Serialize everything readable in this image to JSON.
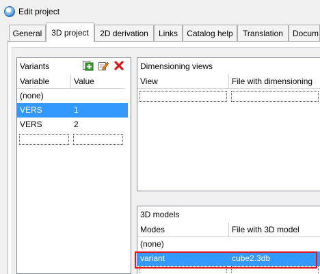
{
  "window": {
    "title": "Edit project"
  },
  "tabs": [
    {
      "label": "General",
      "active": false
    },
    {
      "label": "3D project",
      "active": true
    },
    {
      "label": "2D derivation",
      "active": false
    },
    {
      "label": "Links",
      "active": false
    },
    {
      "label": "Catalog help",
      "active": false
    },
    {
      "label": "Translation",
      "active": false
    },
    {
      "label": "Docum",
      "active": false
    }
  ],
  "variants": {
    "title": "Variants",
    "toolbar": {
      "add_icon": "add-icon",
      "edit_icon": "edit-icon",
      "delete_icon": "delete-icon"
    },
    "columns": [
      "Variable",
      "Value"
    ],
    "rows": [
      {
        "variable": "(none)",
        "value": ""
      },
      {
        "variable": "VERS",
        "value": "1",
        "selected": true
      },
      {
        "variable": "VERS",
        "value": "2"
      }
    ]
  },
  "dimensioning": {
    "title": "Dimensioning views",
    "columns": [
      "View",
      "File with dimensioning"
    ]
  },
  "models": {
    "title": "3D models",
    "columns": [
      "Modes",
      "File with 3D model"
    ],
    "rows": [
      {
        "mode": "(none)",
        "file": ""
      },
      {
        "mode": "variant",
        "file": "cube2.3db",
        "selected": true,
        "highlighted": true
      }
    ]
  },
  "colors": {
    "selection": "#3399ff",
    "highlight_border": "#e0141e"
  }
}
